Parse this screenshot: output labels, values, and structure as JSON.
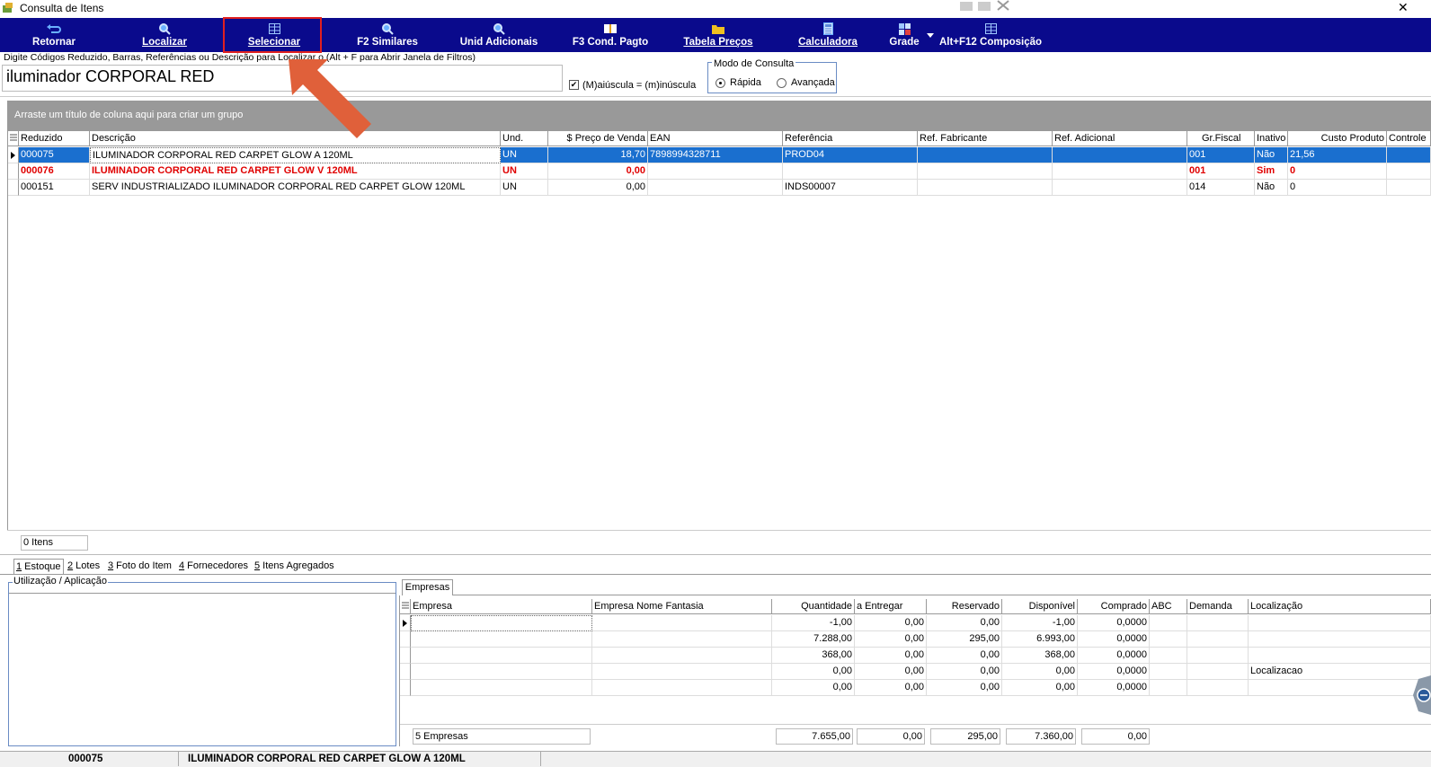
{
  "window": {
    "title": "Consulta de Itens"
  },
  "toolbar": {
    "buttons": [
      {
        "label": "Retornar",
        "icon": "return-icon"
      },
      {
        "label": "Localizar",
        "icon": "search-icon"
      },
      {
        "label": "Selecionar",
        "icon": "grid-icon"
      },
      {
        "label": "F2 Similares",
        "icon": "search-icon"
      },
      {
        "label": "Unid Adicionais",
        "icon": "search-icon"
      },
      {
        "label": "F3 Cond. Pagto",
        "icon": "book-icon"
      },
      {
        "label": "Tabela Preços",
        "icon": "folder-icon"
      },
      {
        "label": "Calculadora",
        "icon": "calculator-icon"
      },
      {
        "label": "Grade",
        "icon": "grid-color-icon"
      },
      {
        "label": "Alt+F12 Composição",
        "icon": "grid-icon"
      }
    ]
  },
  "search": {
    "label": "Digite Códigos Reduzido, Barras, Referências ou Descrição para Localizar o (Alt + F para Abrir Janela de Filtros)",
    "value": "iluminador CORPORAL RED",
    "case_checkbox_label": "(M)aiúscula = (m)inúscula",
    "case_checked": true
  },
  "mode": {
    "title": "Modo de Consulta",
    "options": [
      "Rápida",
      "Avançada"
    ],
    "selected": "Rápida"
  },
  "group_panel_text": "Arraste um título de coluna aqui para criar um grupo",
  "items_grid": {
    "columns": [
      "Reduzido",
      "Descrição",
      "Und.",
      "$ Preço de Venda",
      "EAN",
      "Referência",
      "Ref. Fabricante",
      "Ref. Adicional",
      "Gr.Fiscal",
      "Inativo",
      "Custo Produto",
      "Controle"
    ],
    "rows": [
      {
        "reduzido": "000075",
        "descricao": "ILUMINADOR CORPORAL RED CARPET GLOW A 120ML",
        "und": "UN",
        "preco": "18,70",
        "ean": "7898994328711",
        "referencia": "PROD04",
        "ref_fab": "",
        "ref_adic": "",
        "gr_fiscal": "001",
        "inativo": "Não",
        "custo": "21,56",
        "controle": ""
      },
      {
        "reduzido": "000076",
        "descricao": "ILUMINADOR CORPORAL RED CARPET GLOW V 120ML",
        "und": "UN",
        "preco": "0,00",
        "ean": "",
        "referencia": "",
        "ref_fab": "",
        "ref_adic": "",
        "gr_fiscal": "001",
        "inativo": "Sim",
        "custo": "0",
        "controle": ""
      },
      {
        "reduzido": "000151",
        "descricao": "SERV INDUSTRIALIZADO ILUMINADOR CORPORAL RED CARPET GLOW 120ML",
        "und": "UN",
        "preco": "0,00",
        "ean": "",
        "referencia": "INDS00007",
        "ref_fab": "",
        "ref_adic": "",
        "gr_fiscal": "014",
        "inativo": "Não",
        "custo": "0",
        "controle": ""
      }
    ],
    "footer_count": "0 Itens"
  },
  "tabs": [
    {
      "key": "1",
      "label": " Estoque"
    },
    {
      "key": "2",
      "label": " Lotes"
    },
    {
      "key": "3",
      "label": " Foto do Item"
    },
    {
      "key": "4",
      "label": " Fornecedores"
    },
    {
      "key": "5",
      "label": " Itens Agregados"
    }
  ],
  "utilizacao_label": "Utilização / Aplicação",
  "empresas": {
    "tab_label": "Empresas",
    "columns": [
      "Empresa",
      "Empresa Nome Fantasia",
      "Quantidade",
      "a Entregar",
      "Reservado",
      "Disponível",
      "Comprado",
      "ABC",
      "Demanda",
      "Localização"
    ],
    "rows": [
      {
        "empresa": "",
        "fantasia": "",
        "quantidade": "-1,00",
        "entregar": "0,00",
        "reservado": "0,00",
        "disponivel": "-1,00",
        "comprado": "0,0000",
        "abc": "",
        "demanda": "",
        "localizacao": ""
      },
      {
        "empresa": "",
        "fantasia": "",
        "quantidade": "7.288,00",
        "entregar": "0,00",
        "reservado": "295,00",
        "disponivel": "6.993,00",
        "comprado": "0,0000",
        "abc": "",
        "demanda": "",
        "localizacao": ""
      },
      {
        "empresa": "",
        "fantasia": "",
        "quantidade": "368,00",
        "entregar": "0,00",
        "reservado": "0,00",
        "disponivel": "368,00",
        "comprado": "0,0000",
        "abc": "",
        "demanda": "",
        "localizacao": ""
      },
      {
        "empresa": "",
        "fantasia": "",
        "quantidade": "0,00",
        "entregar": "0,00",
        "reservado": "0,00",
        "disponivel": "0,00",
        "comprado": "0,0000",
        "abc": "",
        "demanda": "",
        "localizacao": "Localizacao"
      },
      {
        "empresa": "",
        "fantasia": "",
        "quantidade": "0,00",
        "entregar": "0,00",
        "reservado": "0,00",
        "disponivel": "0,00",
        "comprado": "0,0000",
        "abc": "",
        "demanda": "",
        "localizacao": ""
      }
    ],
    "footer": {
      "count": "5 Empresas",
      "quantidade": "7.655,00",
      "entregar": "0,00",
      "reservado": "295,00",
      "disponivel": "7.360,00",
      "comprado": "0,00"
    }
  },
  "status": {
    "code": "000075",
    "description": "ILUMINADOR CORPORAL RED CARPET GLOW A 120ML"
  },
  "colors": {
    "toolbar": "#0a0a8c",
    "selection": "#1a6fcf",
    "highlight_box": "#e02020",
    "arrow": "#e0603a",
    "inactive_text": "#e00000"
  }
}
